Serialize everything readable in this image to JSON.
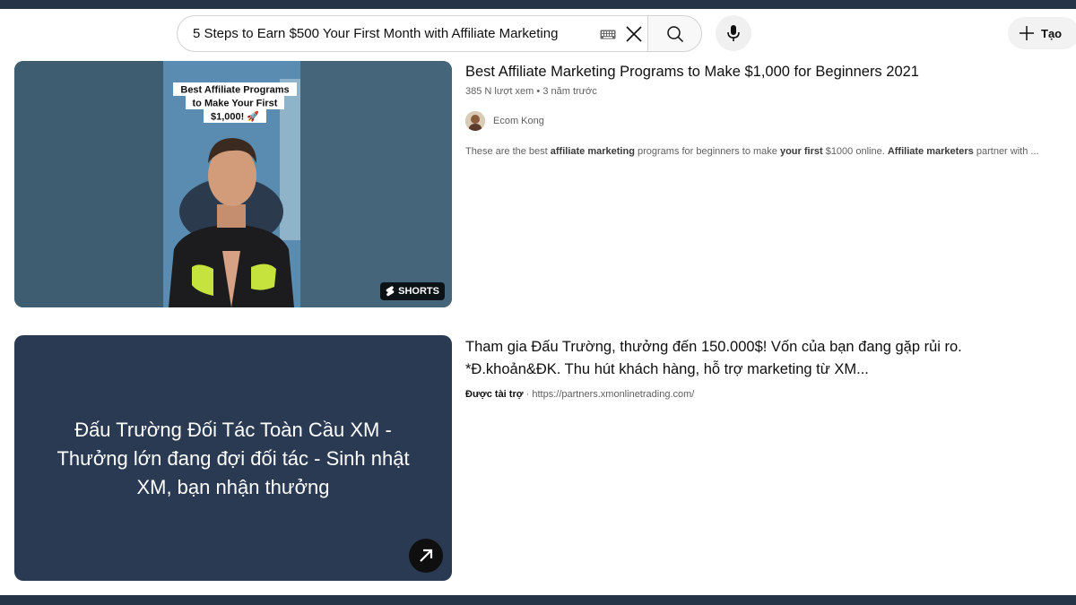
{
  "search": {
    "query": "5 Steps to Earn $500 Your First Month with Affiliate Marketing"
  },
  "header": {
    "create_label": "Tạo"
  },
  "results": [
    {
      "thumbnail_caption": "Best Affiliate Programs to Make Your First $1,000! 🚀",
      "badge": "SHORTS",
      "title": "Best Affiliate Marketing Programs to Make $1,000 for Beginners 2021",
      "views": "385 N lượt xem",
      "age": "3 năm trước",
      "channel": "Ecom Kong",
      "description": {
        "p1": "These are the best ",
        "b1": "affiliate marketing",
        "p2": " programs for beginners to make ",
        "b2": "your first",
        "p3": " $1000 online. ",
        "b3": "Affiliate marketers",
        "p4": " partner with ..."
      }
    },
    {
      "thumbnail_text": "Đấu Trường Đối Tác Toàn Cầu XM - Thưởng lớn đang đợi đối tác - Sinh nhật XM, bạn nhận thưởng",
      "title": "Tham gia Đấu Trường, thưởng đến 150.000$! Vốn của bạn đang gặp rủi ro. *Đ.khoản&ĐK. Thu hút khách hàng, hỗ trợ marketing từ XM...",
      "sponsored_label": "Được tài trợ",
      "url": "https://partners.xmonlinetrading.com/"
    }
  ],
  "colors": {
    "frame": "#263448",
    "ad_background": "#2a3a52",
    "text_primary": "#0f0f0f",
    "text_secondary": "#606060"
  }
}
